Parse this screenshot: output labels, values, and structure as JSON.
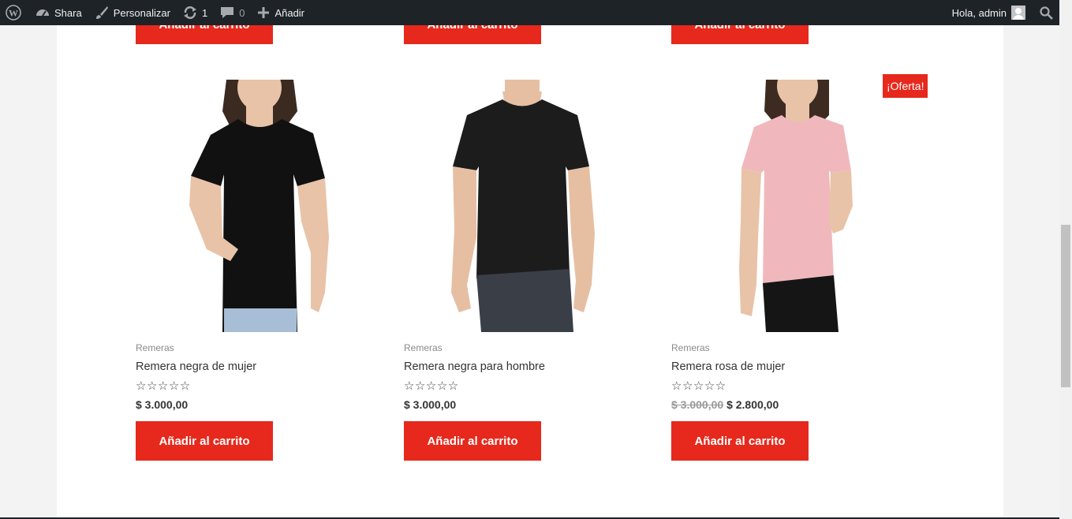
{
  "adminbar": {
    "site_name": "Shara",
    "customize_label": "Personalizar",
    "updates_count": "1",
    "comments_count": "0",
    "new_label": "Añadir",
    "greeting": "Hola, admin"
  },
  "products": [
    {
      "category": "Remeras",
      "title": "Remera negra de mujer",
      "stars": "☆☆☆☆☆",
      "price": "$ 3.000,00",
      "button": "Añadir al carrito"
    },
    {
      "category": "Remeras",
      "title": "Remera negra para hombre",
      "stars": "☆☆☆☆☆",
      "price": "$ 3.000,00",
      "button": "Añadir al carrito"
    },
    {
      "category": "Remeras",
      "title": "Remera rosa de mujer",
      "stars": "☆☆☆☆☆",
      "old_price": "$ 3.000,00",
      "price": "$ 2.800,00",
      "badge": "¡Oferta!",
      "button": "Añadir al carrito"
    }
  ],
  "top_row_buttons": [
    "Añadir al carrito",
    "Añadir al carrito",
    "Añadir al carrito"
  ],
  "colors": {
    "accent": "#e6291c",
    "adminbar": "#1d2327"
  }
}
